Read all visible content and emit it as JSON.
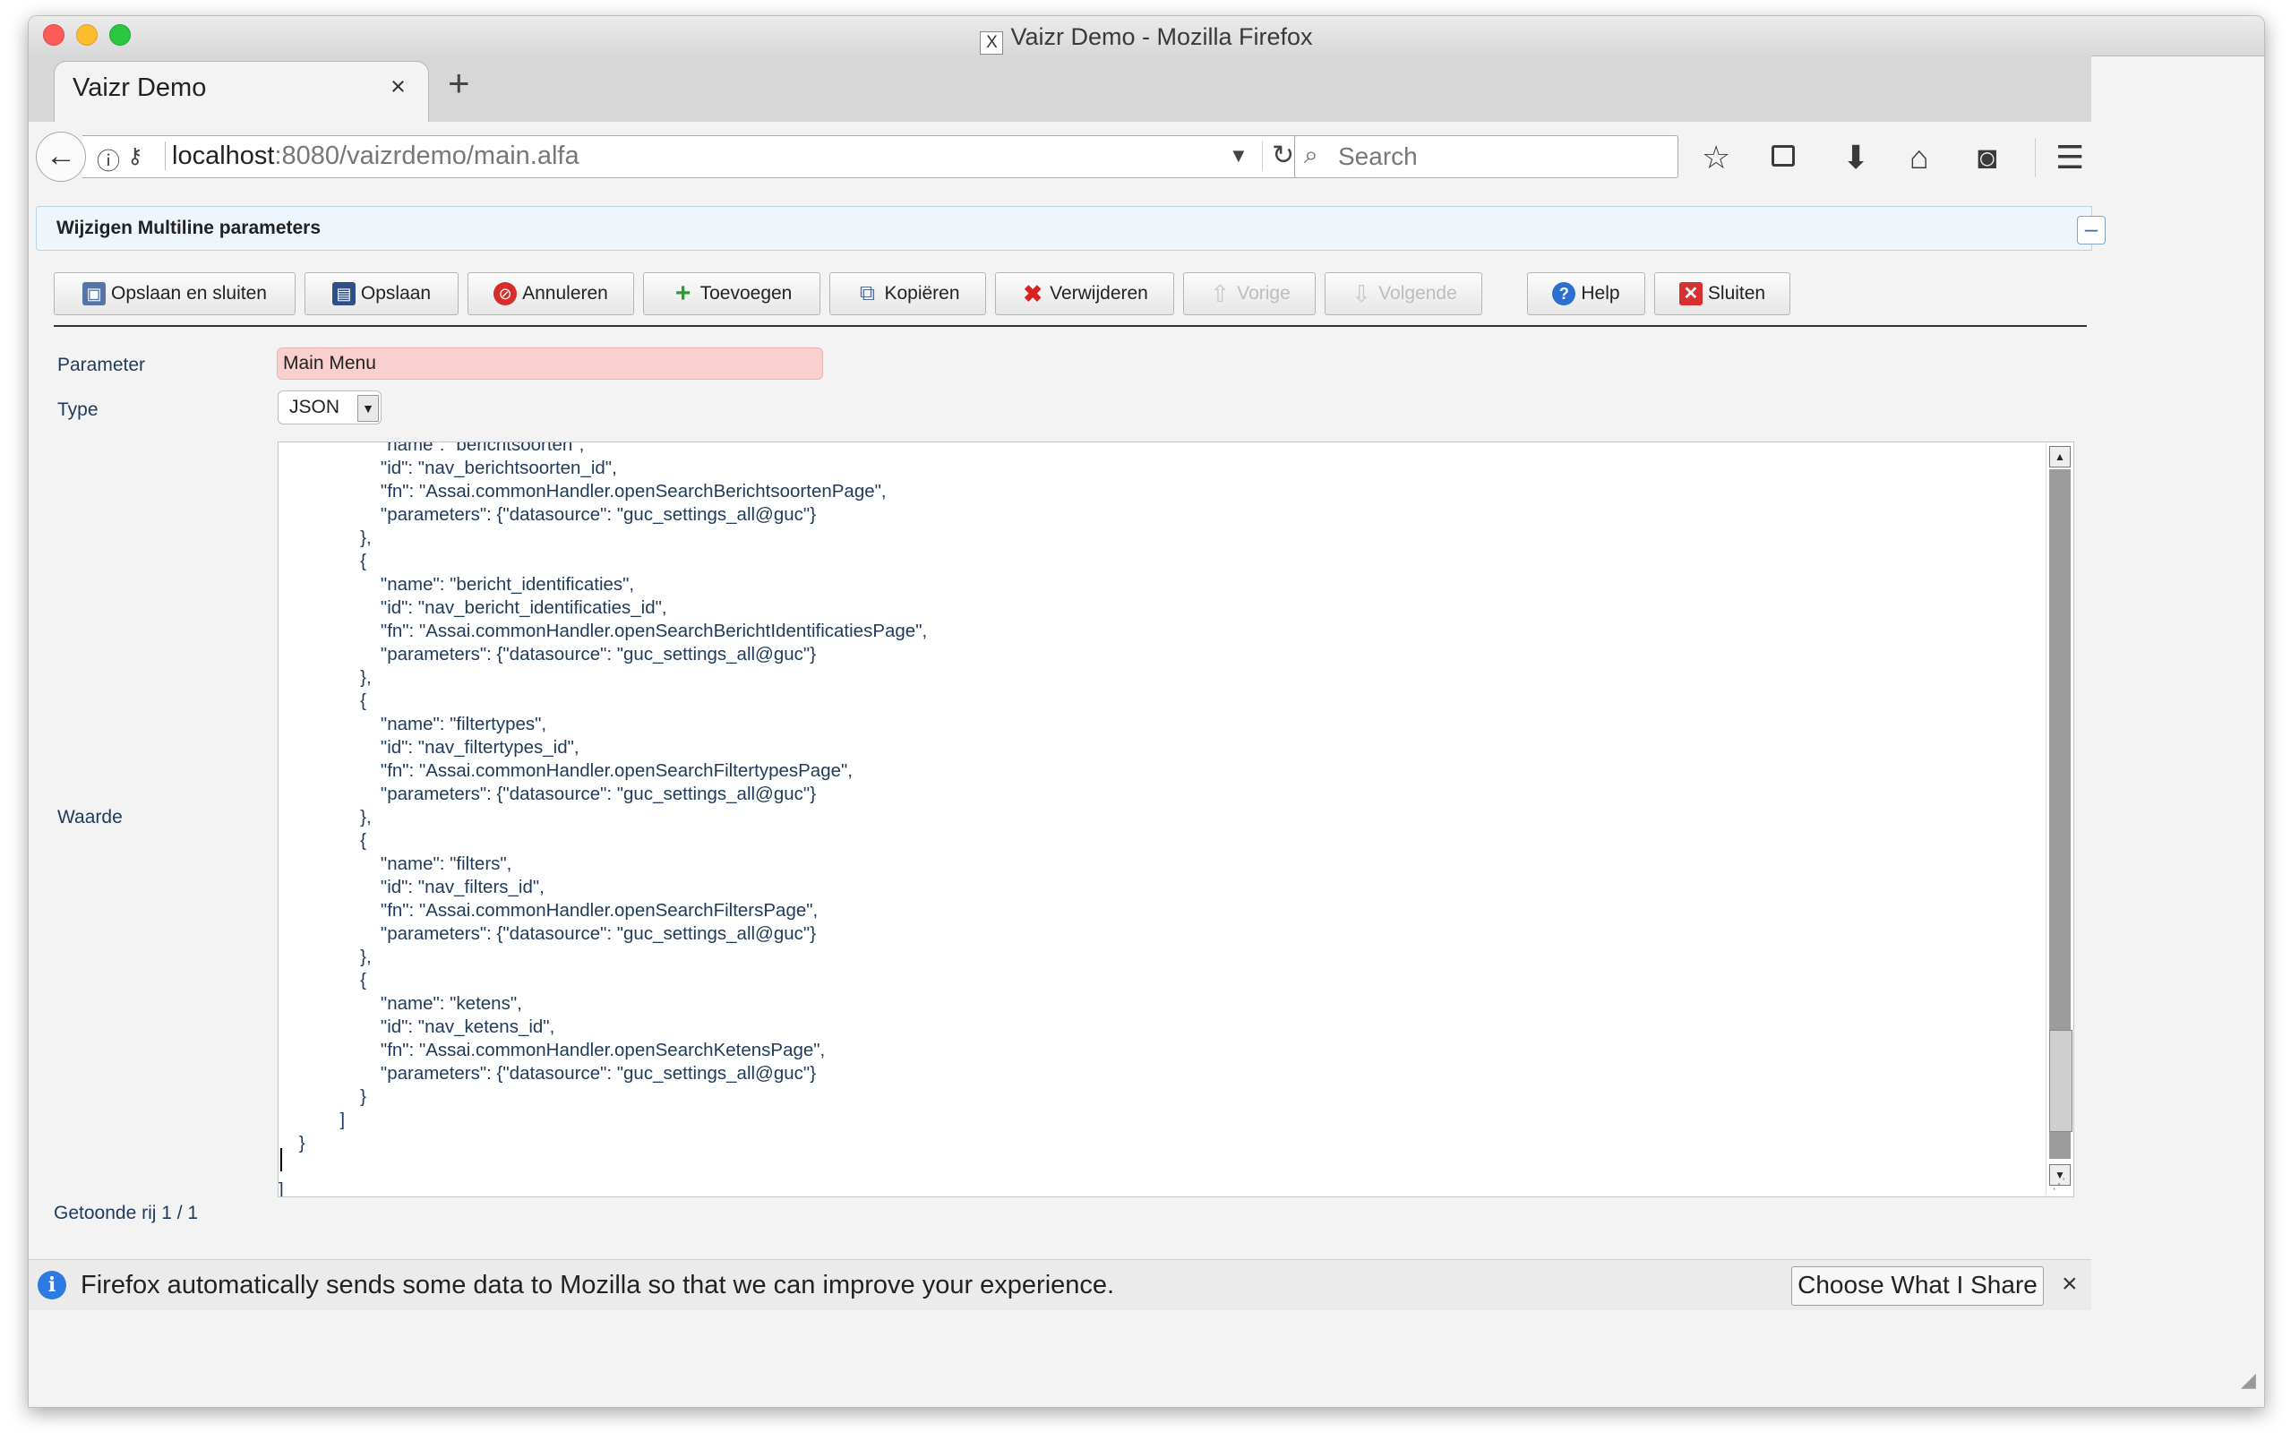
{
  "window": {
    "title": "Vaizr Demo - Mozilla Firefox",
    "x_glyph": "X"
  },
  "tabs": [
    {
      "label": "Vaizr Demo",
      "close": "×"
    }
  ],
  "new_tab_glyph": "+",
  "navbar": {
    "url_host": "localhost",
    "url_rest": ":8080/vaizrdemo/main.alfa",
    "search_placeholder": "Search"
  },
  "panel": {
    "title": "Wijzigen Multiline parameters",
    "collapse_glyph": "–"
  },
  "toolbar": {
    "buttons": [
      {
        "label": "Opslaan en sluiten",
        "icon": "save-close-icon",
        "enabled": true
      },
      {
        "label": "Opslaan",
        "icon": "floppy-icon",
        "enabled": true
      },
      {
        "label": "Annuleren",
        "icon": "cancel-icon",
        "enabled": true
      },
      {
        "label": "Toevoegen",
        "icon": "plus-icon",
        "enabled": true
      },
      {
        "label": "Kopiëren",
        "icon": "copy-icon",
        "enabled": true
      },
      {
        "label": "Verwijderen",
        "icon": "delete-icon",
        "enabled": true
      },
      {
        "label": "Vorige",
        "icon": "arrow-up-icon",
        "enabled": false
      },
      {
        "label": "Volgende",
        "icon": "arrow-down-icon",
        "enabled": false
      },
      {
        "label": "Help",
        "icon": "help-icon",
        "enabled": true
      },
      {
        "label": "Sluiten",
        "icon": "close-icon",
        "enabled": true
      }
    ]
  },
  "form": {
    "parameter_label": "Parameter",
    "parameter_value": "Main Menu",
    "type_label": "Type",
    "type_value": "JSON",
    "waarde_label": "Waarde",
    "waarde_lines": [
      "                    \"name\": \"berichtsoorten\",",
      "                    \"id\": \"nav_berichtsoorten_id\",",
      "                    \"fn\": \"Assai.commonHandler.openSearchBerichtsoortenPage\",",
      "                    \"parameters\": {\"datasource\": \"guc_settings_all@guc\"}",
      "                },",
      "                {",
      "                    \"name\": \"bericht_identificaties\",",
      "                    \"id\": \"nav_bericht_identificaties_id\",",
      "                    \"fn\": \"Assai.commonHandler.openSearchBerichtIdentificatiesPage\",",
      "                    \"parameters\": {\"datasource\": \"guc_settings_all@guc\"}",
      "                },",
      "                {",
      "                    \"name\": \"filtertypes\",",
      "                    \"id\": \"nav_filtertypes_id\",",
      "                    \"fn\": \"Assai.commonHandler.openSearchFiltertypesPage\",",
      "                    \"parameters\": {\"datasource\": \"guc_settings_all@guc\"}",
      "                },",
      "                {",
      "                    \"name\": \"filters\",",
      "                    \"id\": \"nav_filters_id\",",
      "                    \"fn\": \"Assai.commonHandler.openSearchFiltersPage\",",
      "                    \"parameters\": {\"datasource\": \"guc_settings_all@guc\"}",
      "                },",
      "                {",
      "                    \"name\": \"ketens\",",
      "                    \"id\": \"nav_ketens_id\",",
      "                    \"fn\": \"Assai.commonHandler.openSearchKetensPage\",",
      "                    \"parameters\": {\"datasource\": \"guc_settings_all@guc\"}",
      "                }",
      "            ]",
      "    }",
      "",
      "]"
    ]
  },
  "status": {
    "rows_shown": "Getoonde rij 1 / 1"
  },
  "notification": {
    "text": "Firefox automatically sends some data to Mozilla so that we can improve your experience.",
    "button": "Choose What I Share",
    "close": "×"
  },
  "colors": {
    "accent": "#2d7ae0",
    "invalid_field": "#f9cfd0",
    "panel_header": "#eef6fc"
  }
}
